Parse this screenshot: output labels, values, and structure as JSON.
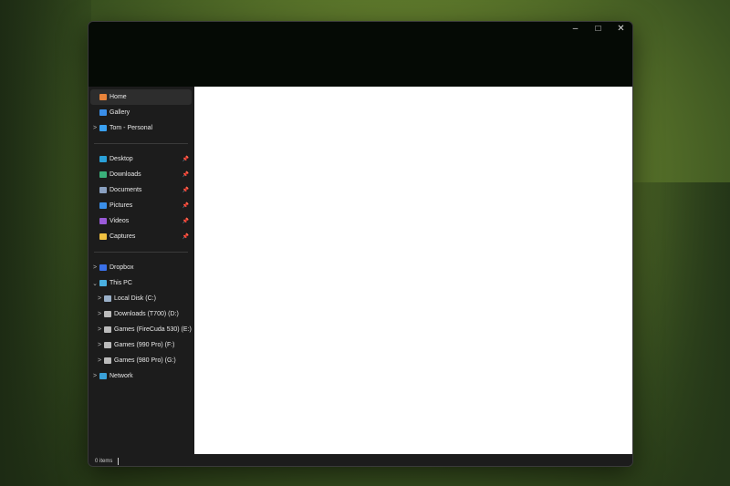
{
  "window_controls": {
    "minimize": "–",
    "maximize": "□",
    "close": "✕"
  },
  "sidebar": {
    "top": [
      {
        "label": "Home",
        "icon": "home-icon",
        "color": "#e8833a",
        "selected": true,
        "chevron": ""
      },
      {
        "label": "Gallery",
        "icon": "gallery-icon",
        "color": "#3a8ee8",
        "chevron": ""
      },
      {
        "label": "Tom - Personal",
        "icon": "onedrive-icon",
        "color": "#3aa0f0",
        "chevron": ">"
      }
    ],
    "quick": [
      {
        "label": "Desktop",
        "icon": "desktop-icon",
        "color": "#2aa0d8",
        "pin": "📌"
      },
      {
        "label": "Downloads",
        "icon": "downloads-icon",
        "color": "#3ab07a",
        "pin": "📌"
      },
      {
        "label": "Documents",
        "icon": "documents-icon",
        "color": "#8aa0c0",
        "pin": "📌"
      },
      {
        "label": "Pictures",
        "icon": "pictures-icon",
        "color": "#3a8ee8",
        "pin": "📌"
      },
      {
        "label": "Videos",
        "icon": "videos-icon",
        "color": "#9a5ad8",
        "pin": "📌"
      },
      {
        "label": "Captures",
        "icon": "folder-icon",
        "color": "#f0c040",
        "pin": "📌"
      }
    ],
    "tree": [
      {
        "label": "Dropbox",
        "icon": "dropbox-icon",
        "color": "#3a70e8",
        "chevron": ">",
        "indent": 0
      },
      {
        "label": "This PC",
        "icon": "pc-icon",
        "color": "#4ab0e0",
        "chevron": "⌄",
        "indent": 0
      },
      {
        "label": "Local Disk (C:)",
        "icon": "drive-icon",
        "color": "#9ab0c8",
        "chevron": ">",
        "indent": 1
      },
      {
        "label": "Downloads (T700) (D:)",
        "icon": "drive-icon",
        "color": "#bbbbbb",
        "chevron": ">",
        "indent": 1
      },
      {
        "label": "Games (FireCuda 530) (E:)",
        "icon": "drive-icon",
        "color": "#bbbbbb",
        "chevron": ">",
        "indent": 1
      },
      {
        "label": "Games (990 Pro) (F:)",
        "icon": "drive-icon",
        "color": "#bbbbbb",
        "chevron": ">",
        "indent": 1
      },
      {
        "label": "Games (980 Pro) (G:)",
        "icon": "drive-icon",
        "color": "#bbbbbb",
        "chevron": ">",
        "indent": 1
      },
      {
        "label": "Network",
        "icon": "network-icon",
        "color": "#3aa0d8",
        "chevron": ">",
        "indent": 0
      }
    ]
  },
  "status": {
    "items": "0 items"
  }
}
